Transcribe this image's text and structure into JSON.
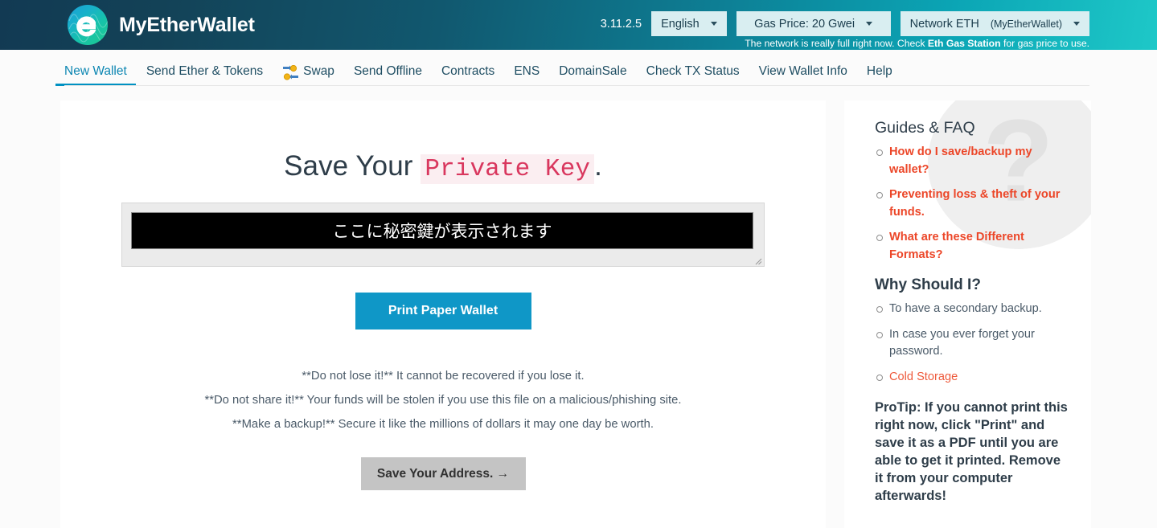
{
  "header": {
    "brand": "MyEtherWallet",
    "logo_icon": "mew-logo-icon",
    "version": "3.11.2.5",
    "language": "English",
    "gas_price": "Gas Price: 20 Gwei",
    "network_label": "Network ETH",
    "network_sub": "(MyEtherWallet)",
    "gas_warning_pre": "The network is really full right now. Check ",
    "gas_warning_link": "Eth Gas Station",
    "gas_warning_post": " for gas price to use.",
    "accent_gradient_start": "#123a53",
    "accent_gradient_end": "#1ec8c8"
  },
  "nav": {
    "items": [
      {
        "label": "New Wallet",
        "active": true
      },
      {
        "label": "Send Ether & Tokens",
        "active": false
      },
      {
        "label": "Swap",
        "active": false,
        "icon": "swap-coins-icon"
      },
      {
        "label": "Send Offline",
        "active": false
      },
      {
        "label": "Contracts",
        "active": false
      },
      {
        "label": "ENS",
        "active": false
      },
      {
        "label": "DomainSale",
        "active": false
      },
      {
        "label": "Check TX Status",
        "active": false
      },
      {
        "label": "View Wallet Info",
        "active": false
      },
      {
        "label": "Help",
        "active": false
      }
    ],
    "active_underline_color": "#0091c2"
  },
  "main": {
    "title_prefix": "Save Your ",
    "title_highlight": "Private Key",
    "title_suffix": ".",
    "highlight_color": "#d9375e",
    "highlight_bg": "#fbeef1",
    "private_key_value": "ここに秘密鍵が表示されます",
    "print_button": "Print Paper Wallet",
    "print_button_color": "#0f97c7",
    "warnings": [
      "**Do not lose it!** It cannot be recovered if you lose it.",
      "**Do not share it!** Your funds will be stolen if you use this file on a malicious/phishing site.",
      "**Make a backup!** Secure it like the millions of dollars it may one day be worth."
    ],
    "save_address_button": "Save Your Address. →"
  },
  "sidebar": {
    "watermark": "?",
    "guides_title": "Guides & FAQ",
    "guides_links": [
      "How do I save/backup my wallet?",
      "Preventing loss & theft of your funds.",
      "What are these Different Formats?"
    ],
    "why_title": "Why Should I?",
    "why_items": [
      {
        "text": "To have a secondary backup.",
        "link": false
      },
      {
        "text": "In case you ever forget your password.",
        "link": false
      },
      {
        "text": "Cold Storage",
        "link": true
      }
    ],
    "protip": "ProTip: If you cannot print this right now, click \"Print\" and save it as a PDF until you are able to get it printed. Remove it from your computer afterwards!",
    "link_color": "#ec4628"
  }
}
